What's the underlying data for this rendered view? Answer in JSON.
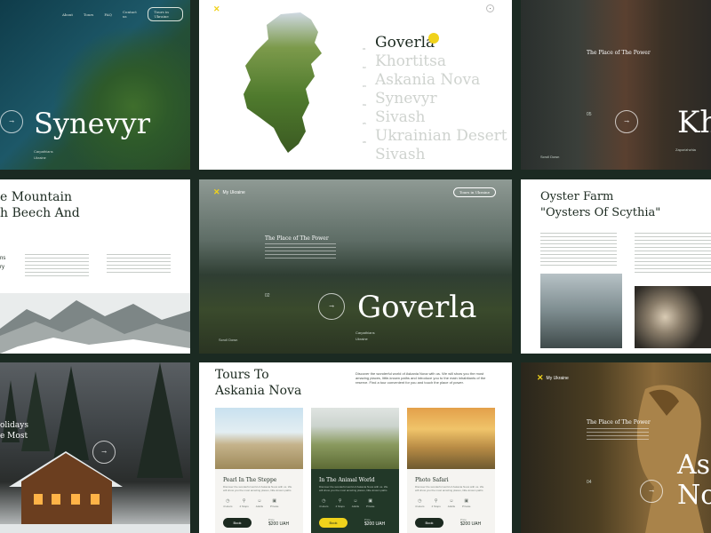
{
  "tile_synevyr": {
    "nav": [
      "About",
      "Tours",
      "FAQ",
      "Contact us"
    ],
    "nav_button": "Tours in Ukraine",
    "title": "Synevyr",
    "caption": "Carpathians",
    "caption_sub": "Ukraine"
  },
  "tile_list": {
    "places": [
      "Goverla",
      "Khortitsa",
      "Askania Nova",
      "Synevyr",
      "Sivash",
      "Ukrainian Desert",
      "Sivash"
    ],
    "numbers": [
      "01",
      "02",
      "03",
      "04",
      "05",
      "06"
    ],
    "accent_color": "#f0d21b"
  },
  "tile_cliffs": {
    "subtitle": "The Place of The Power",
    "title": "Kh",
    "index": "05",
    "caption": "Zaporizhzhia",
    "caption_left": "Scroll Down"
  },
  "tile_mountain_text": {
    "heading_line1": "e Mountain",
    "heading_line2": "h Beech And",
    "side_label_1": "ns",
    "side_label_2": "ry"
  },
  "tile_goverla": {
    "logo": "My Ukraine",
    "nav_button": "Tours in Ukraine",
    "subtitle": "The Place of The Power",
    "title": "Goverla",
    "index": "02",
    "caption": "Carpathians",
    "caption_sub": "Ukraine",
    "scroll": "Scroll Down"
  },
  "tile_oyster": {
    "heading_line1": "Oyster Farm",
    "heading_line2": "\"Oysters Of Scythia\""
  },
  "tile_cabin": {
    "line1": "olidays",
    "line2": "e Most"
  },
  "tile_tours": {
    "heading_line1": "Tours To",
    "heading_line2": "Askania Nova",
    "intro": "Discover the wonderful world of Askania Nova with us. We will show you the most amazing places, little-known paths and introduce you to the main inhabitants of the reserve. Find a tour convenient for you and touch the place of power.",
    "cards": [
      {
        "name": "Pearl In The Steppe",
        "book": "Book",
        "price_label": "Price",
        "price": "$200 UAH",
        "theme": "light"
      },
      {
        "name": "In The Animal World",
        "book": "Book",
        "price_label": "Price",
        "price": "$200 UAH",
        "theme": "dark"
      },
      {
        "name": "Photo Safari",
        "book": "Book",
        "price_label": "Price",
        "price": "$200 UAH",
        "theme": "light"
      }
    ],
    "stats": [
      "4 Hours",
      "4 Stops",
      "Adults",
      "Private"
    ]
  },
  "tile_horses": {
    "logo": "My Ukraine",
    "subtitle": "The Place of The Power",
    "title_line1": "As",
    "title_line2": "No",
    "index": "04"
  }
}
